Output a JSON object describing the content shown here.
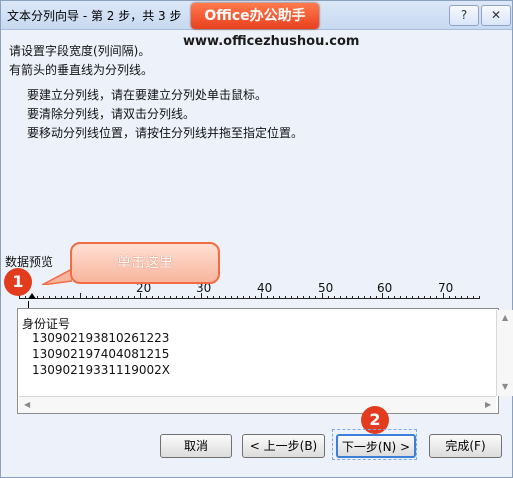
{
  "window": {
    "title": "文本分列向导 - 第 2 步，共 3 步",
    "help_label": "?",
    "close_label": "✕"
  },
  "brand": {
    "label": "Office办公助手",
    "url": "www.officezhushou.com"
  },
  "instructions": {
    "line1": "请设置字段宽度(列间隔)。",
    "line2": "有箭头的垂直线为分列线。",
    "bullet1": "要建立分列线，请在要建立分列处单击鼠标。",
    "bullet2": "要清除分列线，请双击分列线。",
    "bullet3": "要移动分列线位置，请按住分列线并拖至指定位置。"
  },
  "preview": {
    "label": "数据预览",
    "ruler_labels": [
      "20",
      "30",
      "40",
      "50",
      "60",
      "70"
    ],
    "rows": [
      "身份证号",
      "130902193810261223",
      "130902197404081215",
      "13090219331119002X"
    ]
  },
  "callout": {
    "text": "单击这里"
  },
  "badges": {
    "first": "1",
    "second": "2"
  },
  "buttons": {
    "cancel": "取消",
    "back": "< 上一步(B)",
    "next": "下一步(N) >",
    "finish": "完成(F)"
  },
  "colors": {
    "accent": "#e23b1e",
    "callout_border": "#ef6c45",
    "focus_blue": "#3c7fd8"
  }
}
